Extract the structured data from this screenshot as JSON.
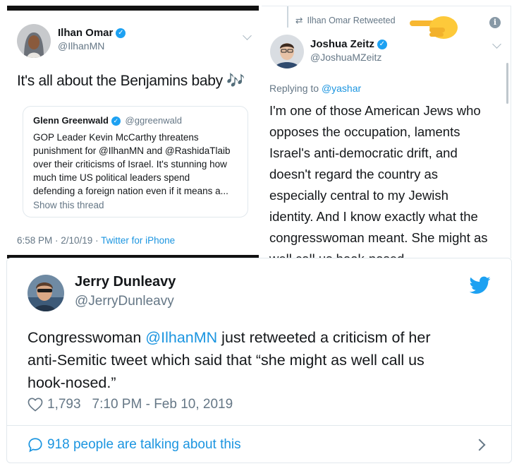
{
  "left_tweet": {
    "name": "Ilhan Omar",
    "handle": "@IlhanMN",
    "text": "It's all about the Benjamins baby 🎶",
    "quote": {
      "name": "Glenn Greenwald",
      "handle": "@ggreenwald",
      "text_lines": [
        "GOP Leader Kevin McCarthy threatens",
        "punishment for @IlhanMN and @RashidaTlaib",
        "over their criticisms of Israel. It's stunning how",
        "much time US political leaders spend",
        "defending a foreign nation even if it means a..."
      ],
      "show_thread": "Show this thread"
    },
    "timestamp": "6:58 PM · 2/10/19 · ",
    "source": "Twitter for iPhone"
  },
  "right_tweet": {
    "retweet_label": "Ilhan Omar Retweeted",
    "name": "Joshua Zeitz",
    "handle": "@JoshuaMZeitz",
    "replying_prefix": "Replying to ",
    "replying_handle": "@yashar",
    "text_lines": [
      "I'm one of those American Jews who",
      "opposes the occupation, laments",
      "Israel's anti-democratic drift, and",
      "doesn't regard the country as",
      "especially central to my Jewish",
      "identity. And I know exactly what the",
      "congresswoman meant. She might as",
      "well call us hook-nosed"
    ]
  },
  "main_tweet": {
    "name": "Jerry Dunleavy",
    "handle": "@JerryDunleavy",
    "text_pre": "Congresswoman ",
    "mention": "@IlhanMN",
    "text_post_line1": " just retweeted a criticism of her",
    "text_line2": "anti-Semitic tweet which said that “she might as well call us",
    "text_line3": "hook-nosed.”",
    "likes": "1,793",
    "timestamp": "7:10 PM - Feb 10, 2019",
    "talking": "918 people are talking about this"
  },
  "colors": {
    "link": "#1b95e0",
    "twitter": "#1da1f2",
    "muted": "#657786"
  }
}
